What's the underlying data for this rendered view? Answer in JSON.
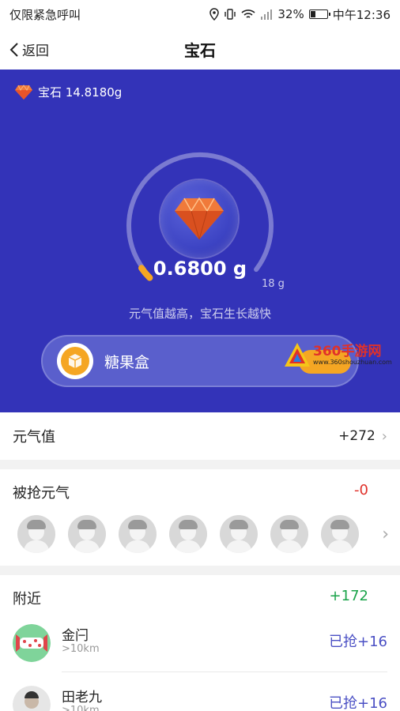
{
  "status_bar": {
    "carrier": "仅限紧急呼叫",
    "battery": "32%",
    "time": "中午12:36"
  },
  "nav": {
    "back_label": "返回",
    "title": "宝石"
  },
  "hero": {
    "gem_total": "宝石 14.8180g",
    "gem_value": "0.6800 g",
    "gauge_max": "18 g",
    "gauge_progress": 0.038,
    "hint": "元气值越高，宝石生长越快",
    "candy_label": "糖果盒",
    "colors": {
      "background": "#3333b8",
      "accent": "#f5a623"
    }
  },
  "watermark": {
    "title": "360手游网",
    "url": "www.360shouzhuan.com"
  },
  "genki": {
    "label": "元气值",
    "value": "+272"
  },
  "robbed": {
    "label": "被抢元气",
    "value": "-0",
    "avatar_count": 7
  },
  "nearby": {
    "label": "附近",
    "value": "+172",
    "people": [
      {
        "name": "金闩",
        "distance": ">10km",
        "action": "已抢+16"
      },
      {
        "name": "田老九",
        "distance": ">10km",
        "action": "已抢+16"
      }
    ]
  }
}
